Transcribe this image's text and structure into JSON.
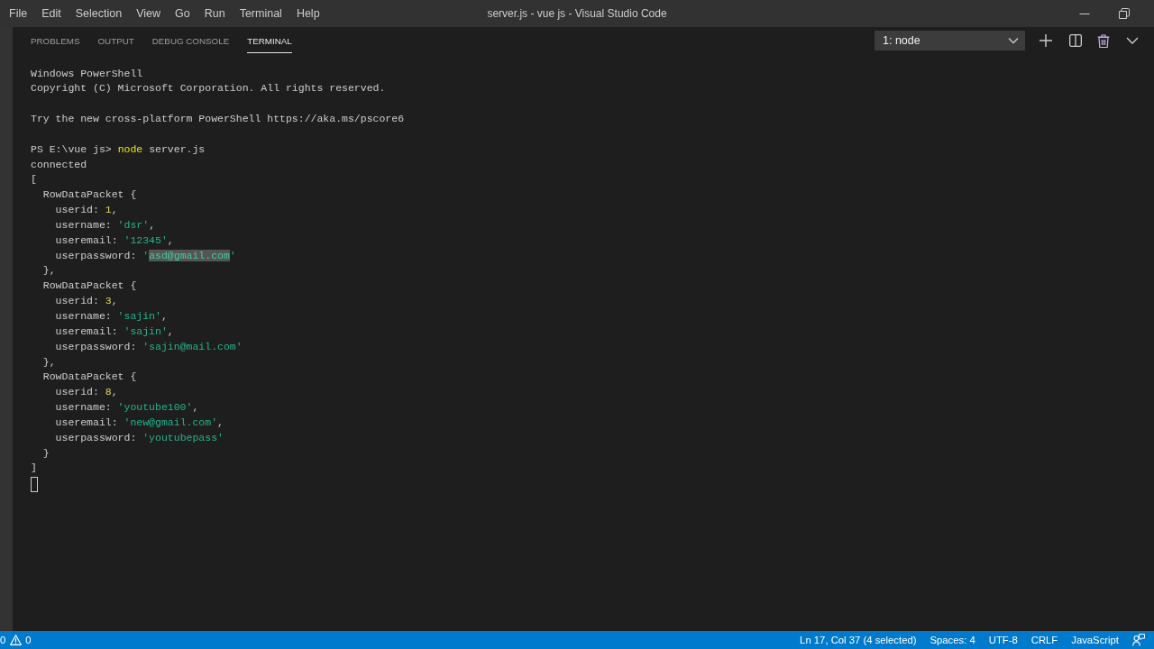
{
  "window": {
    "title": "server.js - vue js - Visual Studio Code"
  },
  "menu": [
    "File",
    "Edit",
    "Selection",
    "View",
    "Go",
    "Run",
    "Terminal",
    "Help"
  ],
  "panel": {
    "tabs": [
      {
        "label": "PROBLEMS",
        "selected": false
      },
      {
        "label": "OUTPUT",
        "selected": false
      },
      {
        "label": "DEBUG CONSOLE",
        "selected": false
      },
      {
        "label": "TERMINAL",
        "selected": true
      }
    ],
    "terminal_picker": {
      "value": "1: node"
    }
  },
  "terminal": {
    "blocks": [
      [
        {
          "segments": [
            {
              "kind": "plain",
              "text": "Windows PowerShell"
            }
          ]
        },
        {
          "segments": [
            {
              "kind": "plain",
              "text": "Copyright (C) Microsoft Corporation. All rights reserved."
            }
          ]
        }
      ],
      [
        {
          "segments": [
            {
              "kind": "plain",
              "text": "Try the new cross-platform PowerShell https://aka.ms/pscore6"
            }
          ]
        }
      ],
      [
        {
          "segments": [
            {
              "kind": "plain",
              "text": "PS E:\\vue js> "
            },
            {
              "kind": "command",
              "text": "node"
            },
            {
              "kind": "plain",
              "text": " server.js"
            }
          ]
        },
        {
          "segments": [
            {
              "kind": "plain",
              "text": "connected"
            }
          ]
        },
        {
          "segments": [
            {
              "kind": "plain",
              "text": "["
            }
          ],
          "children": [
            {
              "segments": [
                {
                  "kind": "plain",
                  "text": "RowDataPacket {"
                }
              ],
              "children": [
                {
                  "segments": [
                    {
                      "kind": "plain",
                      "text": "userid: "
                    },
                    {
                      "kind": "number",
                      "text": "1"
                    },
                    {
                      "kind": "plain",
                      "text": ","
                    }
                  ]
                },
                {
                  "segments": [
                    {
                      "kind": "plain",
                      "text": "username: "
                    },
                    {
                      "kind": "string",
                      "text": "'dsr'"
                    },
                    {
                      "kind": "plain",
                      "text": ","
                    }
                  ]
                },
                {
                  "segments": [
                    {
                      "kind": "plain",
                      "text": "useremail: "
                    },
                    {
                      "kind": "string",
                      "text": "'12345'"
                    },
                    {
                      "kind": "plain",
                      "text": ","
                    }
                  ]
                },
                {
                  "segments": [
                    {
                      "kind": "plain",
                      "text": "userpassword: "
                    },
                    {
                      "kind": "string",
                      "text": "'"
                    },
                    {
                      "kind": "selection",
                      "text": "asd@gmail.com"
                    },
                    {
                      "kind": "string",
                      "text": "'"
                    }
                  ]
                }
              ]
            },
            {
              "segments": [
                {
                  "kind": "plain",
                  "text": "},"
                }
              ]
            },
            {
              "segments": [
                {
                  "kind": "plain",
                  "text": "RowDataPacket {"
                }
              ],
              "children": [
                {
                  "segments": [
                    {
                      "kind": "plain",
                      "text": "userid: "
                    },
                    {
                      "kind": "number",
                      "text": "3"
                    },
                    {
                      "kind": "plain",
                      "text": ","
                    }
                  ]
                },
                {
                  "segments": [
                    {
                      "kind": "plain",
                      "text": "username: "
                    },
                    {
                      "kind": "string",
                      "text": "'sajin'"
                    },
                    {
                      "kind": "plain",
                      "text": ","
                    }
                  ]
                },
                {
                  "segments": [
                    {
                      "kind": "plain",
                      "text": "useremail: "
                    },
                    {
                      "kind": "string",
                      "text": "'sajin'"
                    },
                    {
                      "kind": "plain",
                      "text": ","
                    }
                  ]
                },
                {
                  "segments": [
                    {
                      "kind": "plain",
                      "text": "userpassword: "
                    },
                    {
                      "kind": "string",
                      "text": "'sajin@mail.com'"
                    }
                  ]
                }
              ]
            },
            {
              "segments": [
                {
                  "kind": "plain",
                  "text": "},"
                }
              ]
            },
            {
              "segments": [
                {
                  "kind": "plain",
                  "text": "RowDataPacket {"
                }
              ],
              "children": [
                {
                  "segments": [
                    {
                      "kind": "plain",
                      "text": "userid: "
                    },
                    {
                      "kind": "number",
                      "text": "8"
                    },
                    {
                      "kind": "plain",
                      "text": ","
                    }
                  ]
                },
                {
                  "segments": [
                    {
                      "kind": "plain",
                      "text": "username: "
                    },
                    {
                      "kind": "string",
                      "text": "'youtube100'"
                    },
                    {
                      "kind": "plain",
                      "text": ","
                    }
                  ]
                },
                {
                  "segments": [
                    {
                      "kind": "plain",
                      "text": "useremail: "
                    },
                    {
                      "kind": "string",
                      "text": "'new@gmail.com'"
                    },
                    {
                      "kind": "plain",
                      "text": ","
                    }
                  ]
                },
                {
                  "segments": [
                    {
                      "kind": "plain",
                      "text": "userpassword: "
                    },
                    {
                      "kind": "string",
                      "text": "'youtubepass'"
                    }
                  ]
                }
              ]
            },
            {
              "segments": [
                {
                  "kind": "plain",
                  "text": "}"
                }
              ]
            }
          ]
        },
        {
          "segments": [
            {
              "kind": "plain",
              "text": "]"
            }
          ]
        }
      ]
    ],
    "cursor": true
  },
  "status_bar": {
    "errors": "0",
    "warnings": "0",
    "items": [
      "Ln 17, Col 37 (4 selected)",
      "Spaces: 4",
      "UTF-8",
      "CRLF",
      "JavaScript"
    ]
  }
}
